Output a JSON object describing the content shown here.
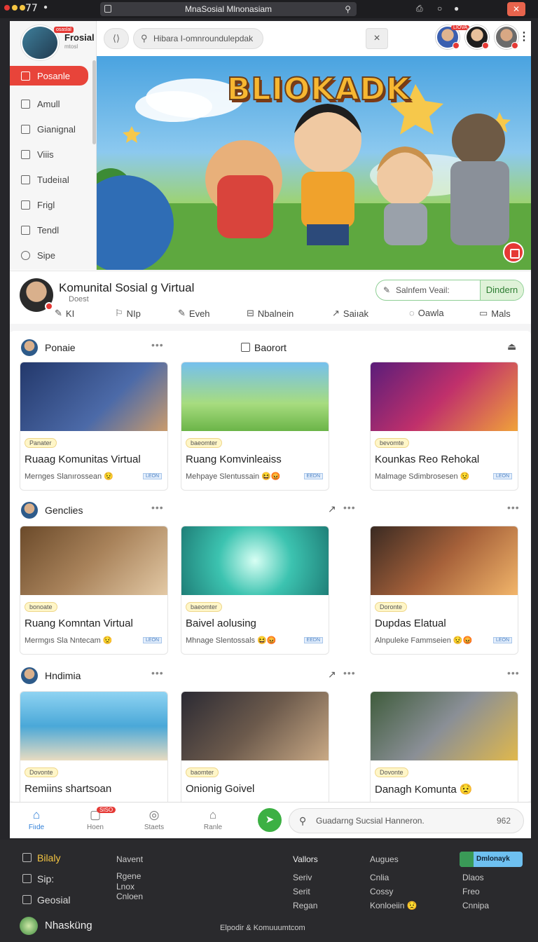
{
  "browser": {
    "time": "77",
    "address": "MnaSosial Mlnonasiam",
    "dot_colors": [
      "#e53935",
      "#f4c542",
      "#f4c542",
      "#e53935"
    ]
  },
  "sidebar": {
    "profile_name": "Frosial",
    "profile_sub": "mtosl",
    "profile_badge": "osaslal",
    "items": [
      {
        "label": "Posanle",
        "icon": "home-icon",
        "active": true
      },
      {
        "label": "Amull",
        "icon": "house-icon"
      },
      {
        "label": "Gianignal",
        "icon": "square-icon"
      },
      {
        "label": "Viiis",
        "icon": "bookmark-icon"
      },
      {
        "label": "Tudeiıal",
        "icon": "house-icon"
      },
      {
        "label": "Frigl",
        "icon": "square-icon"
      },
      {
        "label": "Tendl",
        "icon": "tag-icon"
      },
      {
        "label": "Sipe",
        "icon": "circle-icon"
      }
    ]
  },
  "header": {
    "search_placeholder": "Hibara I-omnroundulepdak",
    "avatar_badge": "LIOVA"
  },
  "hero": {
    "title": "BLIOKADK"
  },
  "community": {
    "title": "Komunital  Sosial g Virtual",
    "subtitle": "Doest",
    "cta_label": "Salnfem Veail:",
    "cta_button": "Dindern",
    "actions": [
      {
        "label": "KI",
        "icon": "edit-icon"
      },
      {
        "label": "NIp",
        "icon": "flag-icon"
      },
      {
        "label": "Eveh",
        "icon": "edit-icon"
      },
      {
        "label": "Nbalnein",
        "icon": "bookmark-icon"
      },
      {
        "label": "Saiıak",
        "icon": "share-icon"
      },
      {
        "label": "Oawla",
        "icon": "chat-icon"
      },
      {
        "label": "Mals",
        "icon": "chat-icon"
      }
    ]
  },
  "sections": [
    {
      "title": "Ponaie",
      "mid_title": "Baorort",
      "cards": [
        {
          "tag": "Panater",
          "title": "Ruaag Komunitas Virtual",
          "meta": "Mernges Slanırossean 😟",
          "chip": "LEON"
        },
        {
          "tag": "baeomter",
          "title": "Ruang Komvinleaiss",
          "meta": "Mehpaye Slentussain 😆😡",
          "chip": "EEDN"
        },
        {
          "tag": "bevomte",
          "title": "Kounkas Reo Rehokal",
          "meta": "Malmage Sdimbrosesen 😟",
          "chip": "LEON"
        }
      ]
    },
    {
      "title": "Genclies",
      "cards": [
        {
          "tag": "bonoate",
          "title": "Ruang Komntan Virtual",
          "meta": "Mermgıs Sla Nntecam 😟",
          "chip": "LEON"
        },
        {
          "tag": "baeomter",
          "title": "Baivel aolusing",
          "meta": "Mhnage Slentossals 😆😡",
          "chip": "EEDN"
        },
        {
          "tag": "Doronte",
          "title": "Dupdas Elatual",
          "meta": "Alnpuleke Fammseien 😟😡",
          "chip": "LEON"
        }
      ]
    },
    {
      "title": "Hndimia",
      "cards": [
        {
          "tag": "Dovonte",
          "title": "Remiins shartsoan",
          "meta": "",
          "chip": ""
        },
        {
          "tag": "baomter",
          "title": "Onionig Goivel",
          "meta": "",
          "chip": ""
        },
        {
          "tag": "Dovonte",
          "title": "Danagh Komunta 😟",
          "meta": "",
          "chip": ""
        }
      ]
    }
  ],
  "bottom_nav": {
    "tabs": [
      {
        "label": "Fiıde",
        "icon": "home-icon",
        "active": true
      },
      {
        "label": "Hoen",
        "icon": "doc-icon",
        "badge": "SISO"
      },
      {
        "label": "Staets",
        "icon": "target-icon"
      },
      {
        "label": "Ranle",
        "icon": "house-icon"
      }
    ],
    "search_placeholder": "Guadarng Sucsial Hanneron.",
    "search_count": "962"
  },
  "footer": {
    "links": [
      {
        "label": "Bilaly",
        "icon": "square-icon",
        "highlight": true
      },
      {
        "label": "Sip:",
        "icon": "record-icon"
      },
      {
        "label": "Geosial",
        "icon": "doc-icon"
      }
    ],
    "col1": [
      "Navent",
      "Rgene",
      "Lnox",
      "Cnloen"
    ],
    "col2_title": "Vallors",
    "col2": [
      "Seriv",
      "Serit",
      "Regan"
    ],
    "col3_title": "Augues",
    "col3": [
      "Cnlia",
      "Cossy",
      "Konloeiin 😟"
    ],
    "col4": [
      "Dlaos",
      "Freo",
      "Cnnipa"
    ],
    "badge_button": "Dmlonayk",
    "brand_name": "Nhasküng",
    "copyright": "Elpodir & Komuuumtcom"
  }
}
